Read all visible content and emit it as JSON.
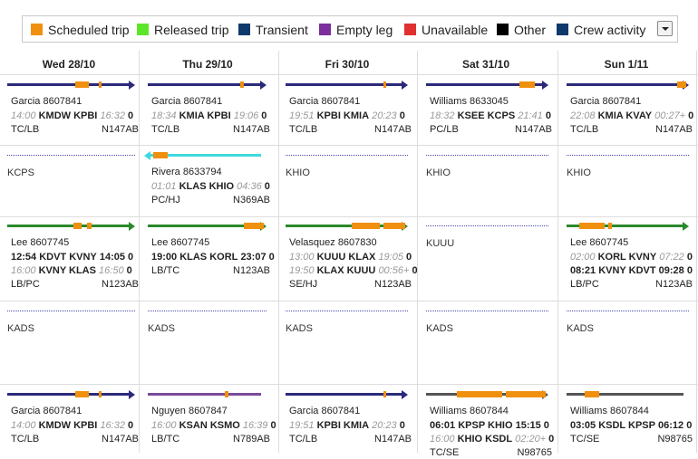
{
  "legend": {
    "items": [
      {
        "label": "Scheduled trip",
        "color": "#f0900f"
      },
      {
        "label": "Released trip",
        "color": "#5ce62a"
      },
      {
        "label": "Transient",
        "color": "#0d3a6b"
      },
      {
        "label": "Empty leg",
        "color": "#7a2f9c"
      },
      {
        "label": "Unavailable",
        "color": "#e03030"
      },
      {
        "label": "Other",
        "color": "#000000"
      },
      {
        "label": "Crew activity",
        "color": "#0d3a6b"
      }
    ]
  },
  "days": [
    "Wed 28/10",
    "Thu 29/10",
    "Fri 30/10",
    "Sat 31/10",
    "Sun 1/11"
  ],
  "rows": [
    [
      {
        "pilot": "Garcia 8607841",
        "line1": {
          "t1": "14:00",
          "route": "KMDW KPBI",
          "t2": "16:32",
          "n": "0"
        },
        "crew": "TC/LB",
        "tail": "N147AB"
      },
      {
        "pilot": "Garcia 8607841",
        "line1": {
          "t1": "18:34",
          "route": "KMIA KPBI",
          "t2": "19:06",
          "n": "0"
        },
        "crew": "TC/LB",
        "tail": "N147AB"
      },
      {
        "pilot": "Garcia 8607841",
        "line1": {
          "t1": "19:51",
          "route": "KPBI KMIA",
          "t2": "20:23",
          "n": "0"
        },
        "crew": "TC/LB",
        "tail": "N147AB"
      },
      {
        "pilot": "Williams 8633045",
        "line1": {
          "t1": "18:32",
          "route": "KSEE KCPS",
          "t2": "21:41",
          "n": "0"
        },
        "crew": "PC/LB",
        "tail": "N147AB"
      },
      {
        "pilot": "Garcia 8607841",
        "line1": {
          "t1": "22:08",
          "route": "KMIA KVAY",
          "t2": "00:27+",
          "n": "0"
        },
        "crew": "TC/LB",
        "tail": "N147AB"
      }
    ],
    [
      {
        "loc": "KCPS"
      },
      {
        "pilot": "Rivera 8633794",
        "line1": {
          "t1": "01:01",
          "route": "KLAS KHIO",
          "t2": "04:36",
          "n": "0"
        },
        "crew": "PC/HJ",
        "tail": "N369AB"
      },
      {
        "loc": "KHIO"
      },
      {
        "loc": "KHIO"
      },
      {
        "loc": "KHIO"
      }
    ],
    [
      {
        "pilot": "Lee 8607745",
        "line1": {
          "t1": "12:54",
          "route": "KDVT KVNY",
          "t2": "14:05",
          "n": "0"
        },
        "line2": {
          "t1": "16:00",
          "route": "KVNY KLAS",
          "t2": "16:50",
          "n": "0"
        },
        "crew": "LB/PC",
        "tail": "N123AB"
      },
      {
        "pilot": "Lee 8607745",
        "line1": {
          "t1": "19:00",
          "route": "KLAS KORL",
          "t2": "23:07",
          "n": "0"
        },
        "crew": "LB/TC",
        "tail": "N123AB"
      },
      {
        "pilot": "Velasquez 8607830",
        "line1": {
          "t1": "13:00",
          "route": "KUUU KLAX",
          "t2": "19:05",
          "n": "0"
        },
        "line2": {
          "t1": "19:50",
          "route": "KLAX KUUU",
          "t2": "00:56+",
          "n": "0"
        },
        "crew": "SE/HJ",
        "tail": "N123AB"
      },
      {
        "loc": "KUUU"
      },
      {
        "pilot": "Lee 8607745",
        "line1": {
          "t1": "02:00",
          "route": "KORL KVNY",
          "t2": "07:22",
          "n": "0"
        },
        "line2": {
          "t1": "08:21",
          "route": "KVNY KDVT",
          "t2": "09:28",
          "n": "0"
        },
        "crew": "LB/PC",
        "tail": "N123AB"
      }
    ],
    [
      {
        "loc": "KADS"
      },
      {
        "loc": "KADS"
      },
      {
        "loc": "KADS"
      },
      {
        "loc": "KADS"
      },
      {
        "loc": "KADS"
      }
    ],
    [
      {
        "pilot": "Garcia 8607841",
        "line1": {
          "t1": "14:00",
          "route": "KMDW KPBI",
          "t2": "16:32",
          "n": "0"
        },
        "crew": "TC/LB",
        "tail": "N147AB"
      },
      {
        "pilot": "Nguyen 8607847",
        "line1": {
          "t1": "16:00",
          "route": "KSAN KSMO",
          "t2": "16:39",
          "n": "0"
        },
        "crew": "LB/TC",
        "tail": "N789AB"
      },
      {
        "pilot": "Garcia 8607841",
        "line1": {
          "t1": "19:51",
          "route": "KPBI KMIA",
          "t2": "20:23",
          "n": "0"
        },
        "crew": "TC/LB",
        "tail": "N147AB"
      },
      {
        "pilot": "Williams 8607844",
        "line1": {
          "t1": "06:01",
          "route": "KPSP KHIO",
          "t2": "15:15",
          "n": "0"
        },
        "line2": {
          "t1": "16:00",
          "route": "KHIO KSDL",
          "t2": "02:20+",
          "n": "0"
        },
        "crew": "TC/SE",
        "tail": "N98765"
      },
      {
        "pilot": "Williams 8607844",
        "line1": {
          "t1": "03:05",
          "route": "KSDL KPSP",
          "t2": "06:12",
          "n": "0"
        },
        "crew": "TC/SE",
        "tail": "N98765"
      }
    ]
  ]
}
